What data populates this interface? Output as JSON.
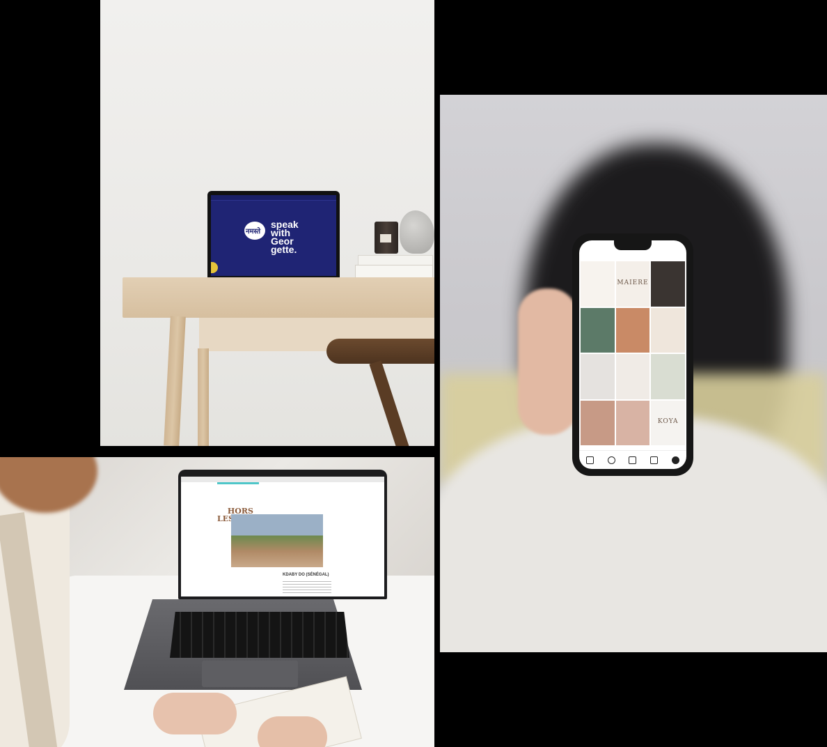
{
  "photos": [
    {
      "id": "desk",
      "laptop_screen": {
        "hindi_text": "नमस्ते",
        "headline": [
          "speak",
          "with",
          "Geor",
          "gette."
        ]
      }
    },
    {
      "id": "phone",
      "tiles": [
        "MAIERE",
        "KOYA"
      ]
    },
    {
      "id": "laptop-woman",
      "laptop_screen": {
        "logo": [
          "HORS",
          "LES MURS"
        ],
        "caption": "KDABY DO (SÉNÉGAL)"
      }
    }
  ],
  "colors": {
    "background": "#000000",
    "screen_navy": "#1f2474",
    "accent_teal": "#4ec6c9"
  }
}
